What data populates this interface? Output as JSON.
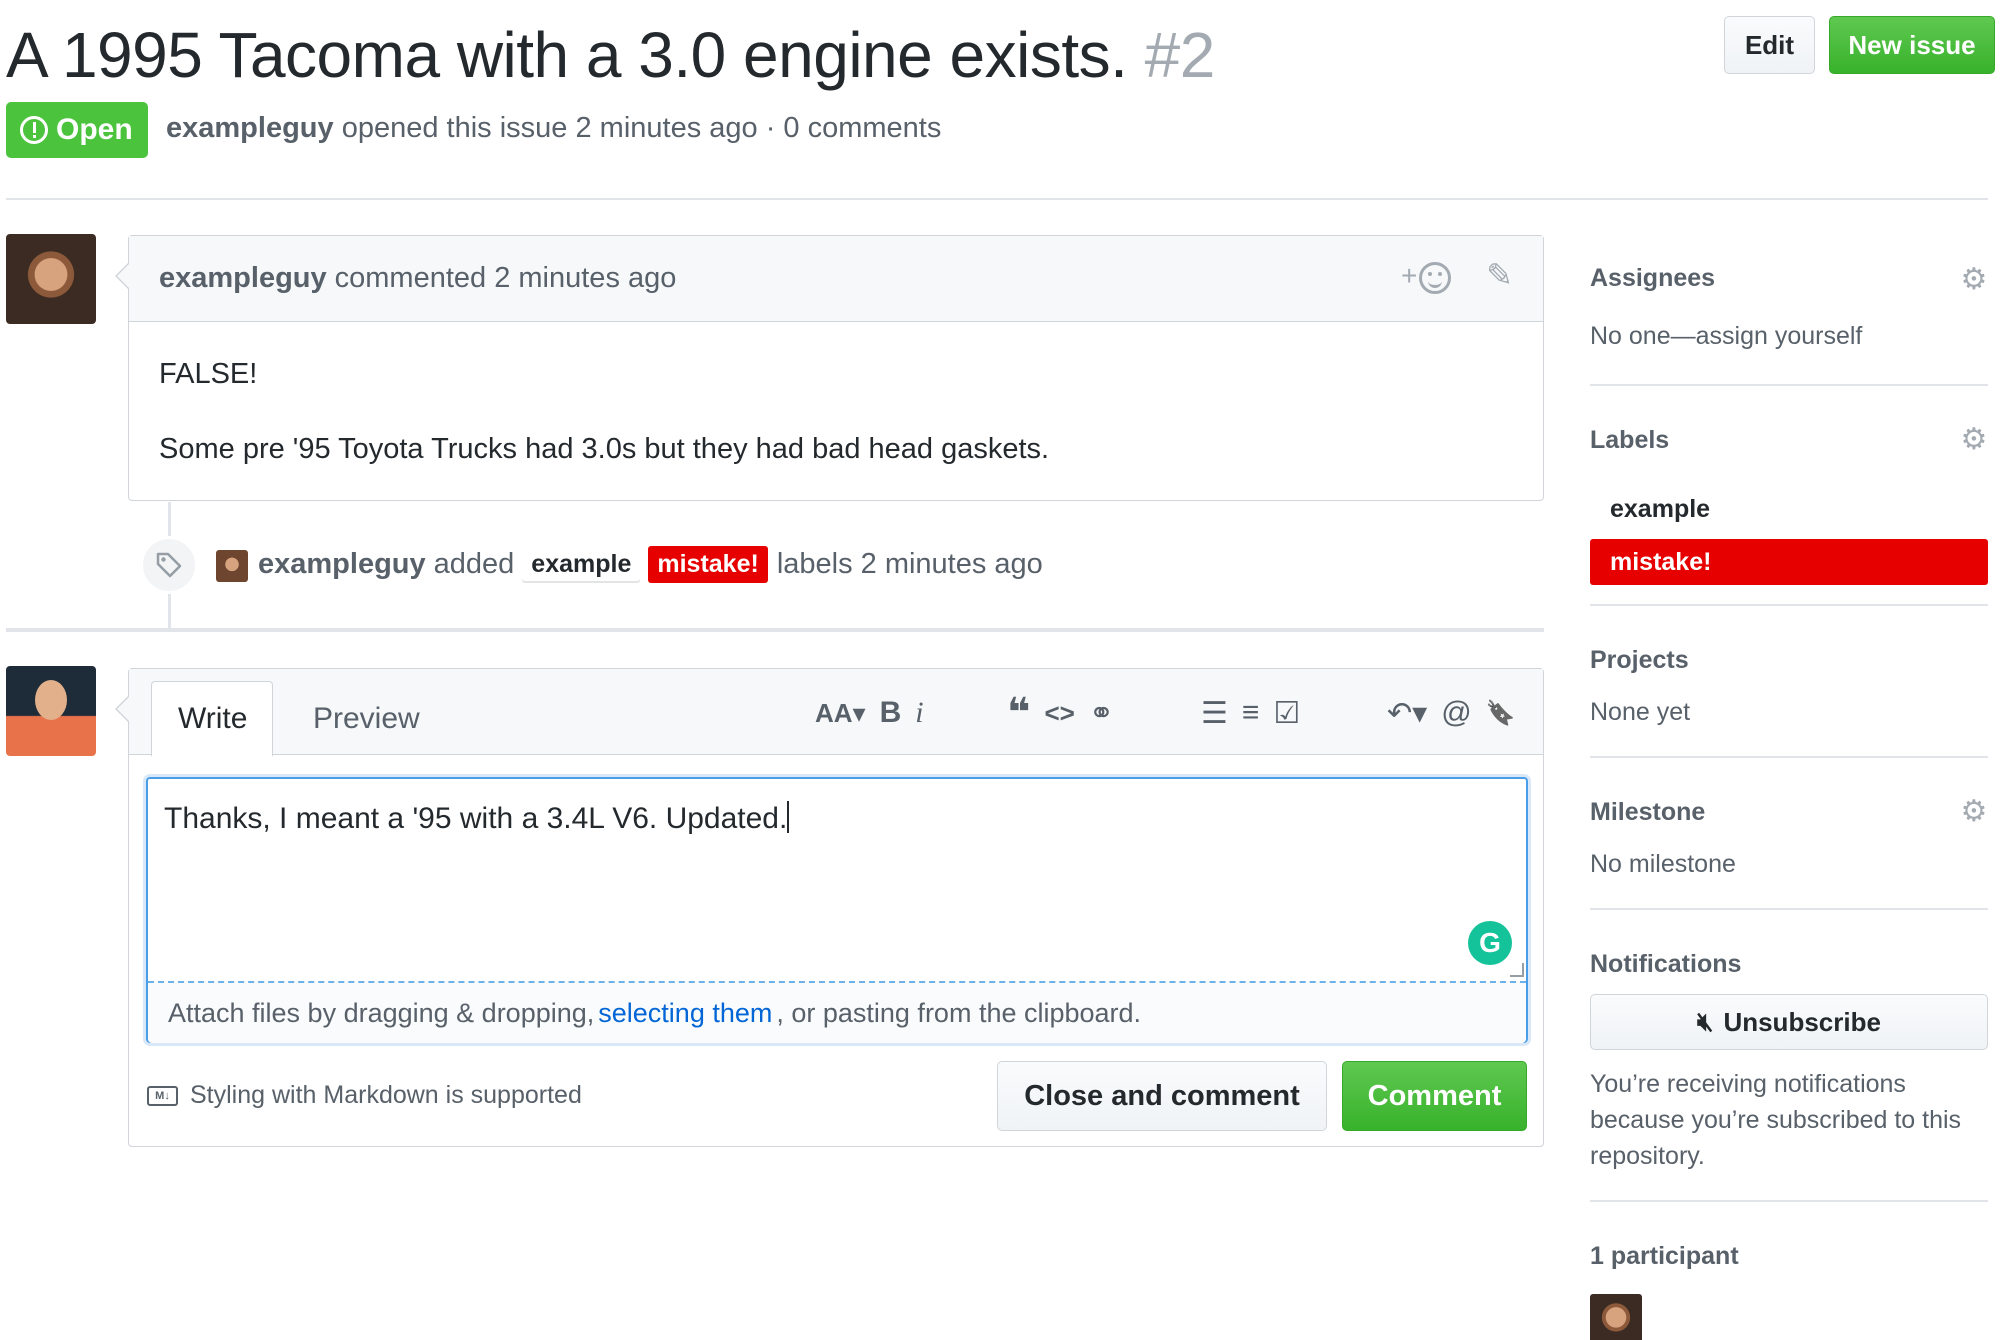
{
  "header": {
    "title": "A 1995 Tacoma with a 3.0 engine exists.",
    "number": "#2",
    "edit_label": "Edit",
    "new_issue_label": "New issue"
  },
  "meta": {
    "state": "Open",
    "author": "exampleguy",
    "text": "opened this issue 2 minutes ago · 0 comments"
  },
  "comment": {
    "author": "exampleguy",
    "action": "commented 2 minutes ago",
    "paragraphs": [
      "FALSE!",
      "Some pre '95 Toyota Trucks had 3.0s but they had bad head gaskets."
    ]
  },
  "event": {
    "author": "exampleguy",
    "verb": "added",
    "labels": [
      "example",
      "mistake!"
    ],
    "suffix": "labels 2 minutes ago"
  },
  "form": {
    "tabs": [
      "Write",
      "Preview"
    ],
    "toolbar": [
      "AA▾",
      "B",
      "i",
      "❝",
      "<>",
      "⚭",
      "☰",
      "≡",
      "☑",
      "↶▾",
      "@",
      "🔖"
    ],
    "textarea_value": "Thanks, I meant a '95 with a 3.4L V6.  Updated.",
    "grammarly": "G",
    "attach_prefix": "Attach files by dragging & dropping,",
    "attach_link": "selecting them",
    "attach_suffix": ", or pasting from the clipboard.",
    "markdown_note": "Styling with Markdown is supported",
    "markdown_icon": "M↓",
    "close_label": "Close and comment",
    "comment_label": "Comment"
  },
  "sidebar": {
    "assignees": {
      "heading": "Assignees",
      "value": "No one—assign yourself"
    },
    "labels": {
      "heading": "Labels",
      "items": [
        "example",
        "mistake!"
      ]
    },
    "projects": {
      "heading": "Projects",
      "value": "None yet"
    },
    "milestone": {
      "heading": "Milestone",
      "value": "No milestone"
    },
    "notifications": {
      "heading": "Notifications",
      "button_label": "Unsubscribe",
      "reason": "You’re receiving notifications because you’re subscribed to this repository."
    },
    "participants": {
      "heading": "1 participant"
    }
  },
  "colors": {
    "open_green": "#4bc33d",
    "mistake_red": "#e60000",
    "link_blue": "#0366d6"
  }
}
